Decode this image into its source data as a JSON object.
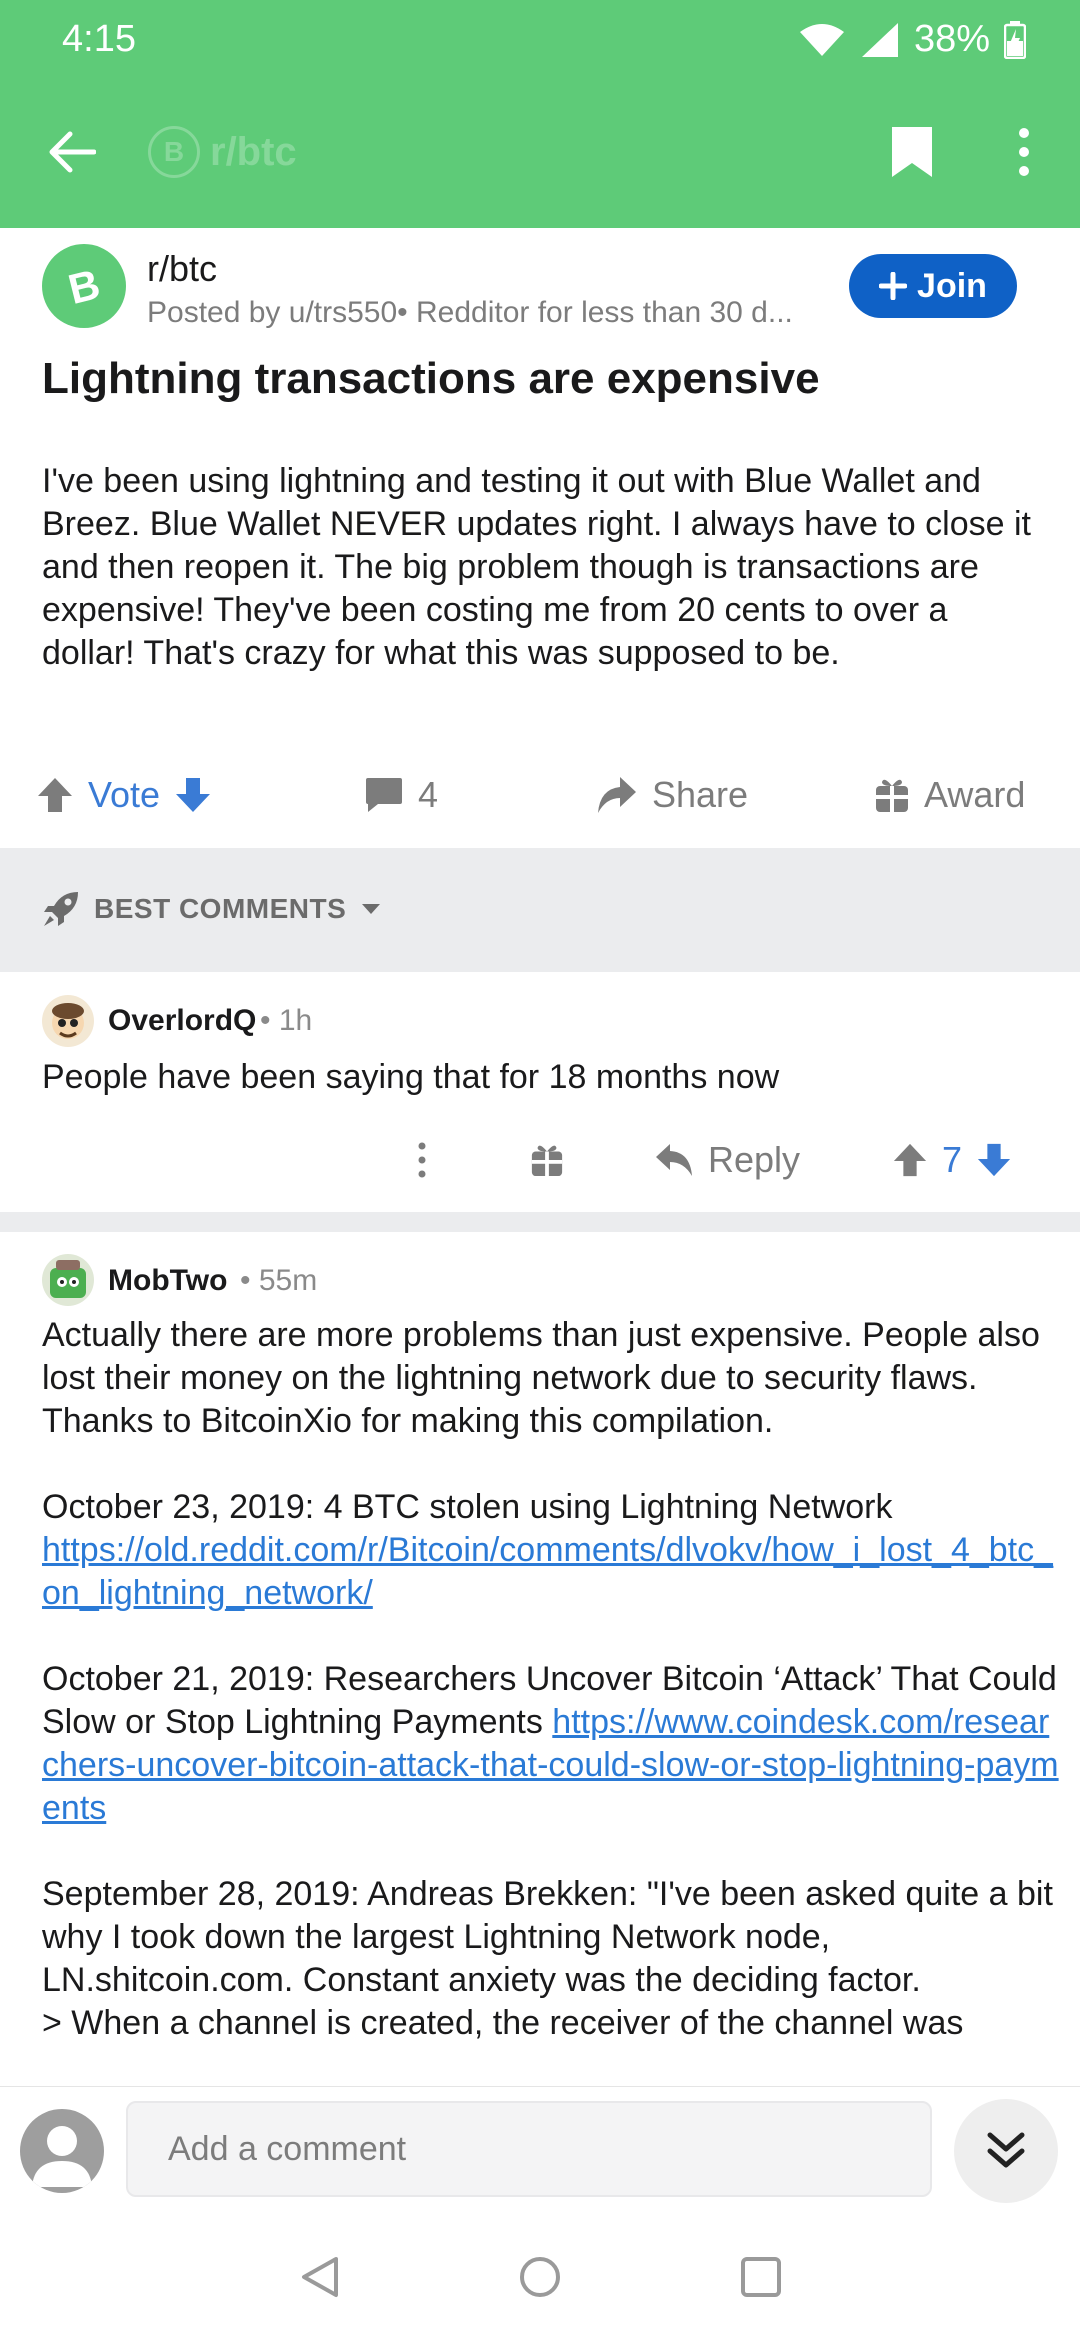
{
  "status_bar": {
    "time": "4:15",
    "battery": "38%"
  },
  "app_bar": {
    "ghost_title": "r/btc",
    "ghost_logo": "B",
    "icons": [
      "back-arrow-icon",
      "bookmark-icon",
      "more-vert-icon"
    ]
  },
  "post": {
    "subreddit": "r/btc",
    "avatar_letter": "B",
    "posted_by": "Posted by u/trs550• Redditor for less than 30 d...",
    "join_label": "Join",
    "title": "Lightning transactions are expensive",
    "body": "I've been using lightning and testing it out with Blue Wallet and Breez.  Blue Wallet NEVER updates right.  I always have to close it and then reopen it.  The big problem though is transactions are expensive!  They've been costing me from 20 cents to over a dollar!  That's crazy for what this was supposed to be.",
    "vote_label": "Vote",
    "comments_count": "4",
    "share_label": "Share",
    "award_label": "Award"
  },
  "sort": {
    "label": "BEST COMMENTS"
  },
  "comments": [
    {
      "author": "OverlordQ",
      "time": "• 1h",
      "text": "People have been saying that for 18 months now",
      "reply_label": "Reply",
      "score": "7"
    },
    {
      "author": "MobTwo",
      "time": "• 55m",
      "p1": "Actually there are more problems than just expensive. People also lost their money on the lightning network due to security flaws. Thanks to BitcoinXio for making this compilation.",
      "p2_text": "October 23, 2019: 4 BTC stolen using Lightning Network",
      "p2_link": "https://old.reddit.com/r/Bitcoin/comments/dlvokv/how_i_lost_4_btc_on_lightning_network/",
      "p3_text": "October 21, 2019: Researchers Uncover Bitcoin ‘Attack’ That Could Slow or Stop Lightning Payments ",
      "p3_link": "https://www.coindesk.com/researchers-uncover-bitcoin-attack-that-could-slow-or-stop-lightning-payments",
      "p4_text": "September 28, 2019: Andreas Brekken: \"I've been asked quite a bit why I took down the largest Lightning Network node, LN.shitcoin.com. Constant anxiety was the deciding factor.",
      "p4_quote": "> When a channel is created, the receiver of the channel was"
    }
  ],
  "comment_input": {
    "placeholder": "Add a comment"
  },
  "colors": {
    "header": "#5ecb78",
    "join": "#0f61c6",
    "link": "#2a7ad6",
    "vote": "#3a7bd5"
  }
}
